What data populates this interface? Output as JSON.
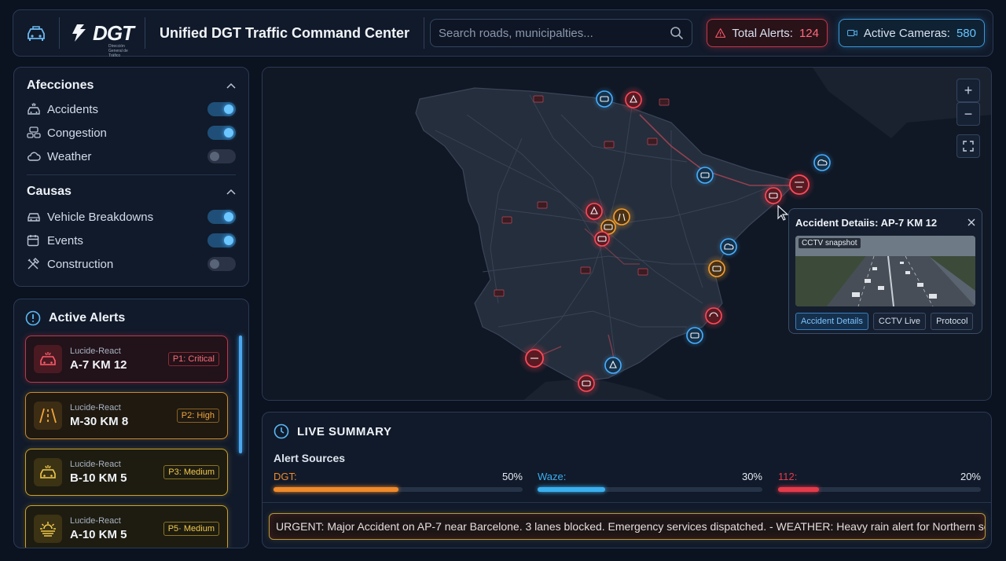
{
  "header": {
    "logo_text": "DGT",
    "logo_subtext": "Dirección General de Tráfico",
    "title": "Unified DGT Traffic Command Center",
    "search_placeholder": "Search roads, municipalties...",
    "alerts_label": "Total Alerts:",
    "alerts_count": "124",
    "cameras_label": "Active Cameras:",
    "cameras_count": "580"
  },
  "filters": {
    "afecciones": {
      "title": "Afecciones",
      "items": [
        {
          "label": "Accidents",
          "icon": "car-crash-icon",
          "enabled": true
        },
        {
          "label": "Congestion",
          "icon": "traffic-jam-icon",
          "enabled": true
        },
        {
          "label": "Weather",
          "icon": "cloud-icon",
          "enabled": false
        }
      ]
    },
    "causas": {
      "title": "Causas",
      "items": [
        {
          "label": "Vehicle Breakdowns",
          "icon": "car-icon",
          "enabled": true
        },
        {
          "label": "Events",
          "icon": "calendar-icon",
          "enabled": true
        },
        {
          "label": "Construction",
          "icon": "tools-icon",
          "enabled": false
        }
      ]
    }
  },
  "active_alerts": {
    "title": "Active Alerts",
    "items": [
      {
        "source": "Lucide-React",
        "road": "A-7 KM 12",
        "priority": "P1: Critical",
        "level": "critical",
        "icon": "car-crash-icon"
      },
      {
        "source": "Lucide-React",
        "road": "M-30 KM 8",
        "priority": "P2: High",
        "level": "high",
        "icon": "road-icon"
      },
      {
        "source": "Lucide-React",
        "road": "B-10 KM 5",
        "priority": "P3: Medium",
        "level": "medium",
        "icon": "car-crash-icon"
      },
      {
        "source": "Lucide-React",
        "road": "A-10 KM 5",
        "priority": "P5· Medium",
        "level": "medium",
        "icon": "sun-haze-icon"
      }
    ]
  },
  "map": {
    "zoom_in": "+",
    "zoom_out": "−",
    "fullscreen_icon": "fullscreen-icon",
    "popup": {
      "title": "Accident Detaiis: AP-7 KM 12",
      "cctv_label": "CCTV snapshot",
      "buttons": [
        "Accident Details",
        "CCTV Live",
        "Protocol"
      ]
    }
  },
  "summary": {
    "title": "LIVE SUMMARY",
    "sources_label": "Alert Sources",
    "sources": [
      {
        "name": "DGT:",
        "percent": "50%",
        "value": 0.5,
        "color": "#f08a2a"
      },
      {
        "name": "Waze:",
        "percent": "30%",
        "value": 0.3,
        "color": "#3ab0f0"
      },
      {
        "name": "112:",
        "percent": "20%",
        "value": 0.2,
        "color": "#e63a4a"
      }
    ],
    "ticker": "URGENT: Major Accident on AP-7 near Barcelone. 3 lanes blocked. Emergency services dispatched. - WEATHER: Heavy rain alert for Northern sector."
  }
}
